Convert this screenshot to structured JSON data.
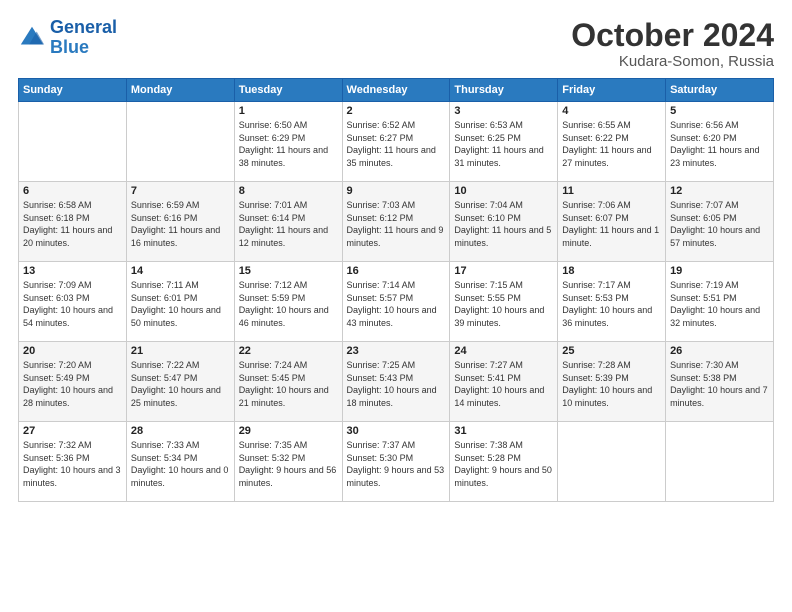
{
  "header": {
    "logo_general": "General",
    "logo_blue": "Blue",
    "month": "October 2024",
    "location": "Kudara-Somon, Russia"
  },
  "days_of_week": [
    "Sunday",
    "Monday",
    "Tuesday",
    "Wednesday",
    "Thursday",
    "Friday",
    "Saturday"
  ],
  "weeks": [
    [
      {
        "day": "",
        "sunrise": "",
        "sunset": "",
        "daylight": ""
      },
      {
        "day": "",
        "sunrise": "",
        "sunset": "",
        "daylight": ""
      },
      {
        "day": "1",
        "sunrise": "Sunrise: 6:50 AM",
        "sunset": "Sunset: 6:29 PM",
        "daylight": "Daylight: 11 hours and 38 minutes."
      },
      {
        "day": "2",
        "sunrise": "Sunrise: 6:52 AM",
        "sunset": "Sunset: 6:27 PM",
        "daylight": "Daylight: 11 hours and 35 minutes."
      },
      {
        "day": "3",
        "sunrise": "Sunrise: 6:53 AM",
        "sunset": "Sunset: 6:25 PM",
        "daylight": "Daylight: 11 hours and 31 minutes."
      },
      {
        "day": "4",
        "sunrise": "Sunrise: 6:55 AM",
        "sunset": "Sunset: 6:22 PM",
        "daylight": "Daylight: 11 hours and 27 minutes."
      },
      {
        "day": "5",
        "sunrise": "Sunrise: 6:56 AM",
        "sunset": "Sunset: 6:20 PM",
        "daylight": "Daylight: 11 hours and 23 minutes."
      }
    ],
    [
      {
        "day": "6",
        "sunrise": "Sunrise: 6:58 AM",
        "sunset": "Sunset: 6:18 PM",
        "daylight": "Daylight: 11 hours and 20 minutes."
      },
      {
        "day": "7",
        "sunrise": "Sunrise: 6:59 AM",
        "sunset": "Sunset: 6:16 PM",
        "daylight": "Daylight: 11 hours and 16 minutes."
      },
      {
        "day": "8",
        "sunrise": "Sunrise: 7:01 AM",
        "sunset": "Sunset: 6:14 PM",
        "daylight": "Daylight: 11 hours and 12 minutes."
      },
      {
        "day": "9",
        "sunrise": "Sunrise: 7:03 AM",
        "sunset": "Sunset: 6:12 PM",
        "daylight": "Daylight: 11 hours and 9 minutes."
      },
      {
        "day": "10",
        "sunrise": "Sunrise: 7:04 AM",
        "sunset": "Sunset: 6:10 PM",
        "daylight": "Daylight: 11 hours and 5 minutes."
      },
      {
        "day": "11",
        "sunrise": "Sunrise: 7:06 AM",
        "sunset": "Sunset: 6:07 PM",
        "daylight": "Daylight: 11 hours and 1 minute."
      },
      {
        "day": "12",
        "sunrise": "Sunrise: 7:07 AM",
        "sunset": "Sunset: 6:05 PM",
        "daylight": "Daylight: 10 hours and 57 minutes."
      }
    ],
    [
      {
        "day": "13",
        "sunrise": "Sunrise: 7:09 AM",
        "sunset": "Sunset: 6:03 PM",
        "daylight": "Daylight: 10 hours and 54 minutes."
      },
      {
        "day": "14",
        "sunrise": "Sunrise: 7:11 AM",
        "sunset": "Sunset: 6:01 PM",
        "daylight": "Daylight: 10 hours and 50 minutes."
      },
      {
        "day": "15",
        "sunrise": "Sunrise: 7:12 AM",
        "sunset": "Sunset: 5:59 PM",
        "daylight": "Daylight: 10 hours and 46 minutes."
      },
      {
        "day": "16",
        "sunrise": "Sunrise: 7:14 AM",
        "sunset": "Sunset: 5:57 PM",
        "daylight": "Daylight: 10 hours and 43 minutes."
      },
      {
        "day": "17",
        "sunrise": "Sunrise: 7:15 AM",
        "sunset": "Sunset: 5:55 PM",
        "daylight": "Daylight: 10 hours and 39 minutes."
      },
      {
        "day": "18",
        "sunrise": "Sunrise: 7:17 AM",
        "sunset": "Sunset: 5:53 PM",
        "daylight": "Daylight: 10 hours and 36 minutes."
      },
      {
        "day": "19",
        "sunrise": "Sunrise: 7:19 AM",
        "sunset": "Sunset: 5:51 PM",
        "daylight": "Daylight: 10 hours and 32 minutes."
      }
    ],
    [
      {
        "day": "20",
        "sunrise": "Sunrise: 7:20 AM",
        "sunset": "Sunset: 5:49 PM",
        "daylight": "Daylight: 10 hours and 28 minutes."
      },
      {
        "day": "21",
        "sunrise": "Sunrise: 7:22 AM",
        "sunset": "Sunset: 5:47 PM",
        "daylight": "Daylight: 10 hours and 25 minutes."
      },
      {
        "day": "22",
        "sunrise": "Sunrise: 7:24 AM",
        "sunset": "Sunset: 5:45 PM",
        "daylight": "Daylight: 10 hours and 21 minutes."
      },
      {
        "day": "23",
        "sunrise": "Sunrise: 7:25 AM",
        "sunset": "Sunset: 5:43 PM",
        "daylight": "Daylight: 10 hours and 18 minutes."
      },
      {
        "day": "24",
        "sunrise": "Sunrise: 7:27 AM",
        "sunset": "Sunset: 5:41 PM",
        "daylight": "Daylight: 10 hours and 14 minutes."
      },
      {
        "day": "25",
        "sunrise": "Sunrise: 7:28 AM",
        "sunset": "Sunset: 5:39 PM",
        "daylight": "Daylight: 10 hours and 10 minutes."
      },
      {
        "day": "26",
        "sunrise": "Sunrise: 7:30 AM",
        "sunset": "Sunset: 5:38 PM",
        "daylight": "Daylight: 10 hours and 7 minutes."
      }
    ],
    [
      {
        "day": "27",
        "sunrise": "Sunrise: 7:32 AM",
        "sunset": "Sunset: 5:36 PM",
        "daylight": "Daylight: 10 hours and 3 minutes."
      },
      {
        "day": "28",
        "sunrise": "Sunrise: 7:33 AM",
        "sunset": "Sunset: 5:34 PM",
        "daylight": "Daylight: 10 hours and 0 minutes."
      },
      {
        "day": "29",
        "sunrise": "Sunrise: 7:35 AM",
        "sunset": "Sunset: 5:32 PM",
        "daylight": "Daylight: 9 hours and 56 minutes."
      },
      {
        "day": "30",
        "sunrise": "Sunrise: 7:37 AM",
        "sunset": "Sunset: 5:30 PM",
        "daylight": "Daylight: 9 hours and 53 minutes."
      },
      {
        "day": "31",
        "sunrise": "Sunrise: 7:38 AM",
        "sunset": "Sunset: 5:28 PM",
        "daylight": "Daylight: 9 hours and 50 minutes."
      },
      {
        "day": "",
        "sunrise": "",
        "sunset": "",
        "daylight": ""
      },
      {
        "day": "",
        "sunrise": "",
        "sunset": "",
        "daylight": ""
      }
    ]
  ]
}
